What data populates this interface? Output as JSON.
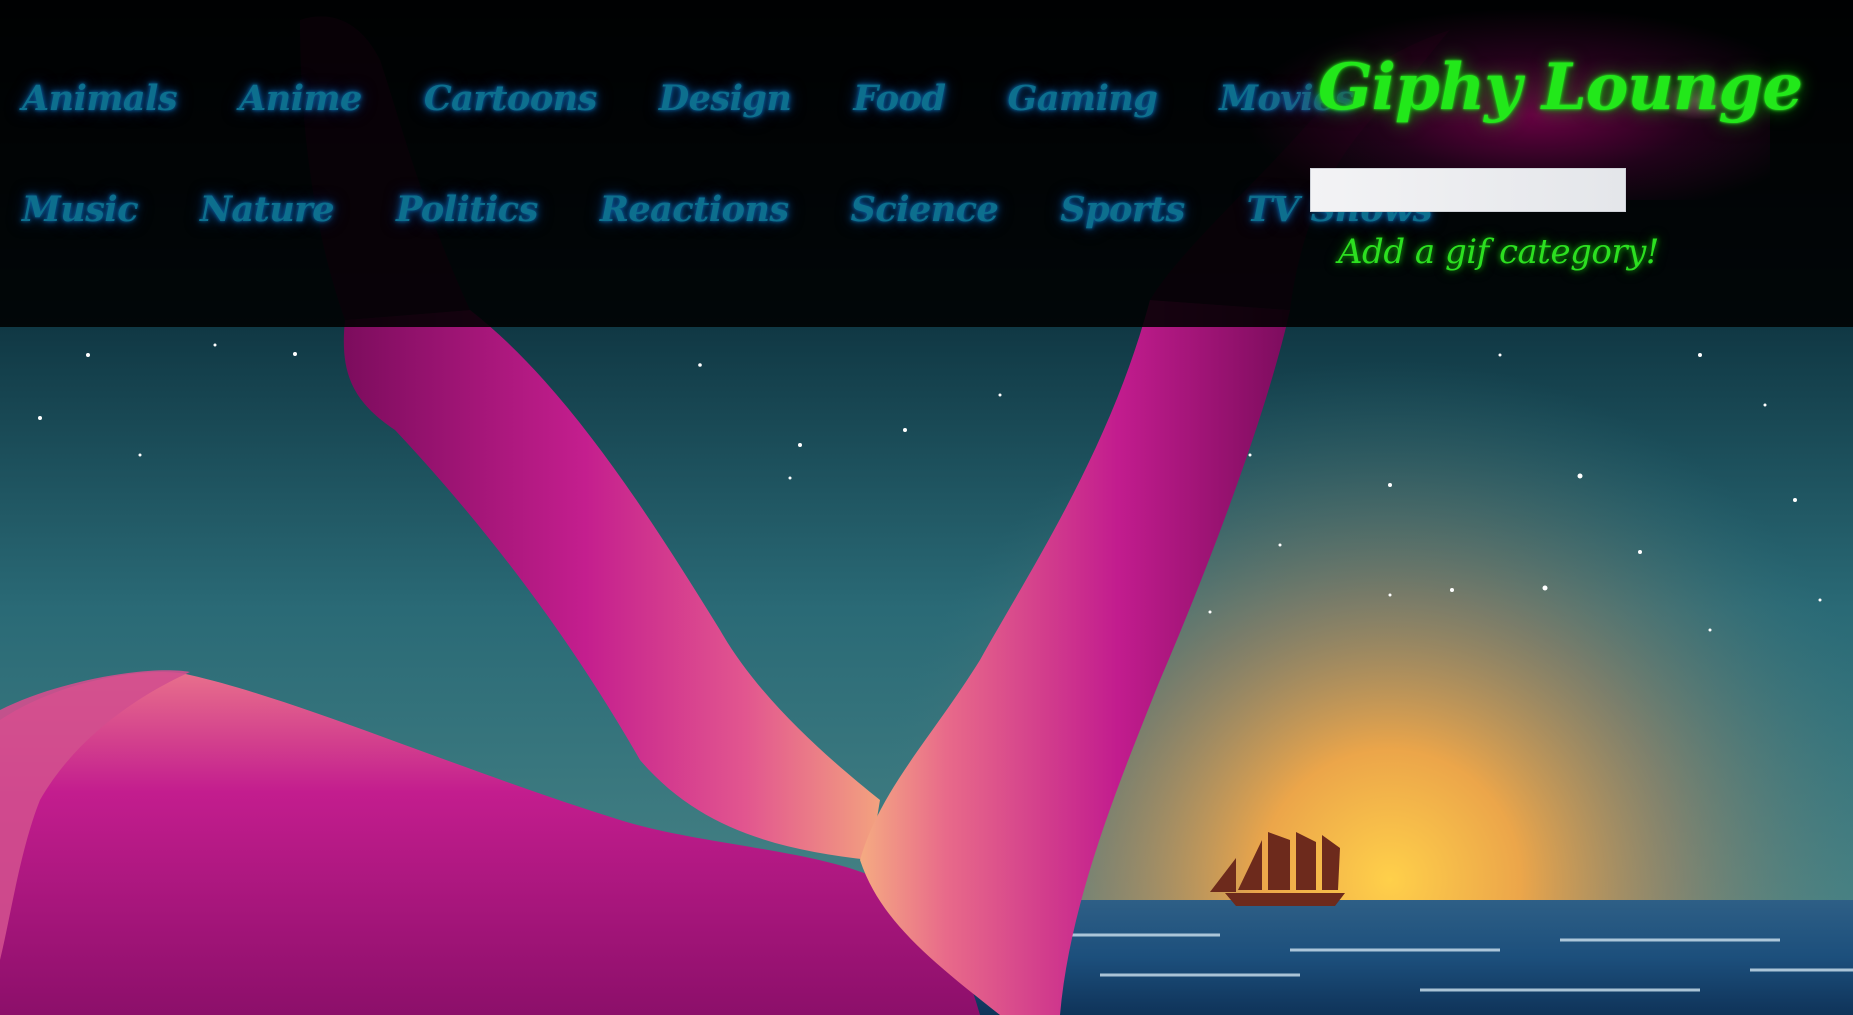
{
  "header": {
    "nav_row_1": [
      {
        "label": "Animals"
      },
      {
        "label": "Anime"
      },
      {
        "label": "Cartoons"
      },
      {
        "label": "Design"
      },
      {
        "label": "Food"
      },
      {
        "label": "Gaming"
      },
      {
        "label": "Movies"
      }
    ],
    "nav_row_2": [
      {
        "label": "Music"
      },
      {
        "label": "Nature"
      },
      {
        "label": "Politics"
      },
      {
        "label": "Reactions"
      },
      {
        "label": "Science"
      },
      {
        "label": "Sports"
      },
      {
        "label": "TV Shows"
      }
    ],
    "brand": {
      "title": "Giphy Lounge"
    },
    "add_category": {
      "input_value": "",
      "link_label": "Add a gif category!"
    }
  },
  "colors": {
    "nav_link": "#0d6f8e",
    "brand_green": "#22e81a",
    "header_background": "#000000",
    "sky_top": "#06191f",
    "sky_mid": "#24616f",
    "sunset_glow": "#f6b24a",
    "sea": "#1b5a86",
    "legs_pink": "#c21c8e",
    "legs_highlight": "#f3a27f"
  },
  "background": {
    "subject": "retro airbrushed illustration of raised legs on a beach at night, a sailing ship on the horizon in front of a sunset glow"
  }
}
